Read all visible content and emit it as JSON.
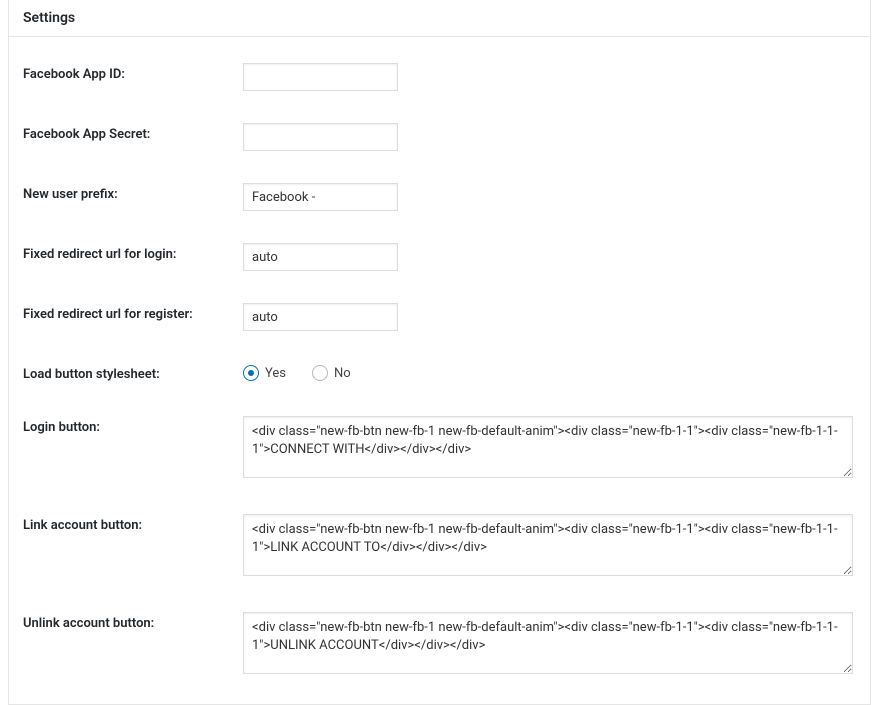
{
  "panel": {
    "title": "Settings"
  },
  "fields": {
    "appId": {
      "label": "Facebook App ID:",
      "value": ""
    },
    "appSecret": {
      "label": "Facebook App Secret:",
      "value": ""
    },
    "userPrefix": {
      "label": "New user prefix:",
      "value": "Facebook -"
    },
    "redirectLogin": {
      "label": "Fixed redirect url for login:",
      "value": "auto"
    },
    "redirectRegister": {
      "label": "Fixed redirect url for register:",
      "value": "auto"
    },
    "loadStylesheet": {
      "label": "Load button stylesheet:",
      "yesLabel": "Yes",
      "noLabel": "No",
      "selected": "yes"
    },
    "loginButton": {
      "label": "Login button:",
      "value": "<div class=\"new-fb-btn new-fb-1 new-fb-default-anim\"><div class=\"new-fb-1-1\"><div class=\"new-fb-1-1-1\">CONNECT WITH</div></div></div>"
    },
    "linkButton": {
      "label": "Link account button:",
      "value": "<div class=\"new-fb-btn new-fb-1 new-fb-default-anim\"><div class=\"new-fb-1-1\"><div class=\"new-fb-1-1-1\">LINK ACCOUNT TO</div></div></div>"
    },
    "unlinkButton": {
      "label": "Unlink account button:",
      "value": "<div class=\"new-fb-btn new-fb-1 new-fb-default-anim\"><div class=\"new-fb-1-1\"><div class=\"new-fb-1-1-1\">UNLINK ACCOUNT</div></div></div>"
    }
  }
}
